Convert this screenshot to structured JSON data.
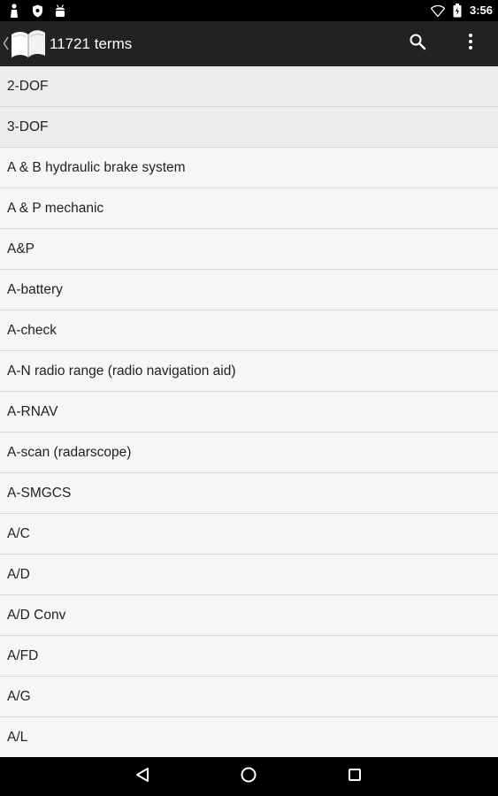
{
  "status_bar": {
    "time": "3:56",
    "icons_left": [
      "person-notification-icon",
      "shield-notification-icon",
      "android-notification-icon"
    ],
    "icons_right": [
      "wifi-icon",
      "battery-icon"
    ]
  },
  "action_bar": {
    "title": "11721 terms",
    "logo_icon": "open-book-icon",
    "actions": [
      "search-icon",
      "overflow-menu-icon"
    ]
  },
  "terms": [
    "2-DOF",
    "3-DOF",
    "A & B hydraulic brake system",
    "A & P mechanic",
    "A&P",
    "A-battery",
    "A-check",
    "A-N radio range (radio navigation aid)",
    "A-RNAV",
    "A-scan (radarscope)",
    "A-SMGCS",
    "A/C",
    "A/D",
    "A/D Conv",
    "A/FD",
    "A/G",
    "A/L"
  ],
  "nav_bar": {
    "buttons": [
      "back-icon",
      "home-icon",
      "recents-icon"
    ]
  }
}
